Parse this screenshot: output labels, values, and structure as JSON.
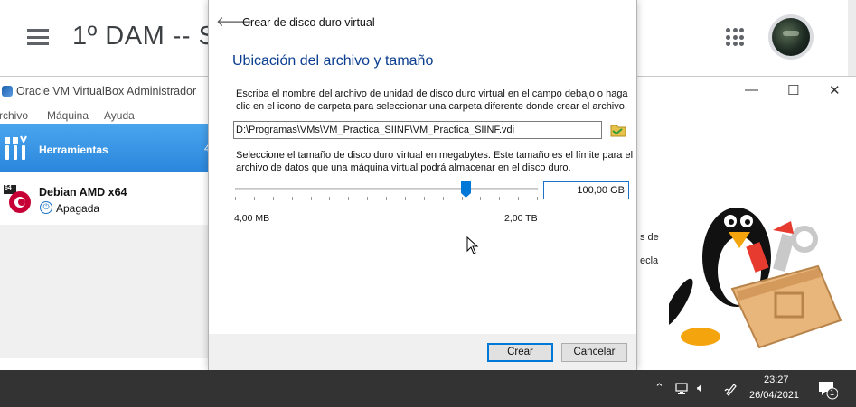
{
  "background_page": {
    "title": "1º DAM -- S",
    "menu_icon": "hamburger-menu-icon",
    "apps_icon": "apps-grid-icon",
    "avatar_icon": "user-avatar"
  },
  "virtualbox": {
    "window_title": "Oracle VM VirtualBox Administrador",
    "controls": {
      "minimize": "—",
      "maximize": "☐",
      "close": "✕"
    },
    "menu": [
      "rchivo",
      "Máquina",
      "Ayuda"
    ],
    "tools_label": "Herramientas",
    "tools_badge": "4",
    "vm": {
      "name": "Debian AMD x64",
      "state": "Apagada",
      "badge": "64"
    },
    "right_text_1": "s de",
    "right_text_2": "ecla"
  },
  "dialog": {
    "title": "Crear de disco duro virtual",
    "heading": "Ubicación del archivo y tamaño",
    "description_location": "Escriba el nombre del archivo de unidad de disco duro virtual en el campo debajo o haga clic en el icono de carpeta para seleccionar una carpeta diferente donde crear el archivo.",
    "file_path": "D:\\Programas\\VMs\\VM_Practica_SIINF\\VM_Practica_SIINF.vdi",
    "description_size": "Seleccione el tamaño de disco duro virtual en megabytes. Este tamaño es el límite para el archivo de datos que una máquina virtual podrá almacenar en el disco duro.",
    "size_value": "100,00 GB",
    "slider_position": 0.76,
    "min_label": "4,00 MB",
    "max_label": "2,00 TB",
    "create_button": "Crear",
    "cancel_button": "Cancelar"
  },
  "taskbar": {
    "time": "23:27",
    "date": "26/04/2021",
    "notification_count": "1",
    "tray_up_icon": "^"
  },
  "colors": {
    "accent": "#0078d7",
    "heading": "#0a3d8f",
    "selection": "#3393e6",
    "taskbar": "#333333"
  }
}
